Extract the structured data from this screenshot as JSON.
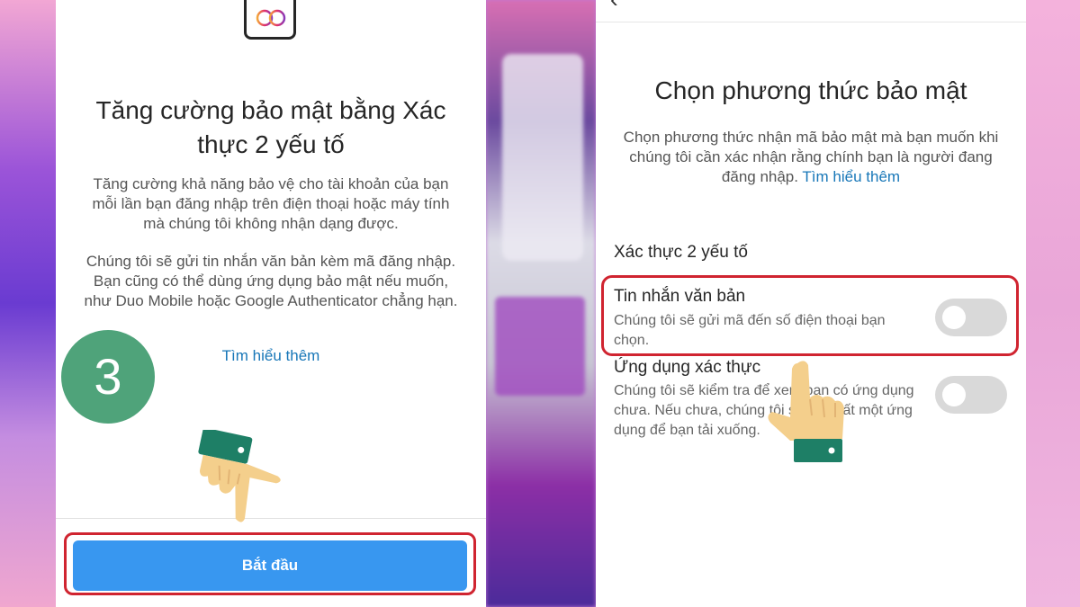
{
  "left": {
    "title": "Tăng cường bảo mật bằng Xác thực 2 yếu tố",
    "paragraph1": "Tăng cường khả năng bảo vệ cho tài khoản của bạn mỗi lần bạn đăng nhập trên điện thoại hoặc máy tính mà chúng tôi không nhận dạng được.",
    "paragraph2": "Chúng tôi sẽ gửi tin nhắn văn bản kèm mã đăng nhập. Bạn cũng có thể dùng ứng dụng bảo mật nếu muốn, như Duo Mobile hoặc Google Authenticator chẳng hạn.",
    "learn_more": "Tìm hiểu thêm",
    "start_button": "Bắt đầu",
    "step_number": "3"
  },
  "right": {
    "title": "Chọn phương thức bảo mật",
    "description": "Chọn phương thức nhận mã bảo mật mà bạn muốn khi chúng tôi cần xác nhận rằng chính bạn là người đang đăng nhập.",
    "learn_more": "Tìm hiểu thêm",
    "section_heading": "Xác thực 2 yếu tố",
    "options": [
      {
        "title": "Tin nhắn văn bản",
        "description": "Chúng tôi sẽ gửi mã đến số điện thoại bạn chọn.",
        "enabled": false
      },
      {
        "title": "Ứng dụng xác thực",
        "description": "Chúng tôi sẽ kiểm tra để xem bạn có ứng dụng chưa. Nếu chưa, chúng tôi sẽ đề xuất một ứng dụng để bạn tải xuống.",
        "enabled": false
      }
    ]
  },
  "colors": {
    "primary_button": "#3897f0",
    "highlight": "#d02430",
    "step_badge": "#4fa37a",
    "link": "#1877b8",
    "cuff": "#1e7f66",
    "hand_skin": "#f4cf8c"
  }
}
